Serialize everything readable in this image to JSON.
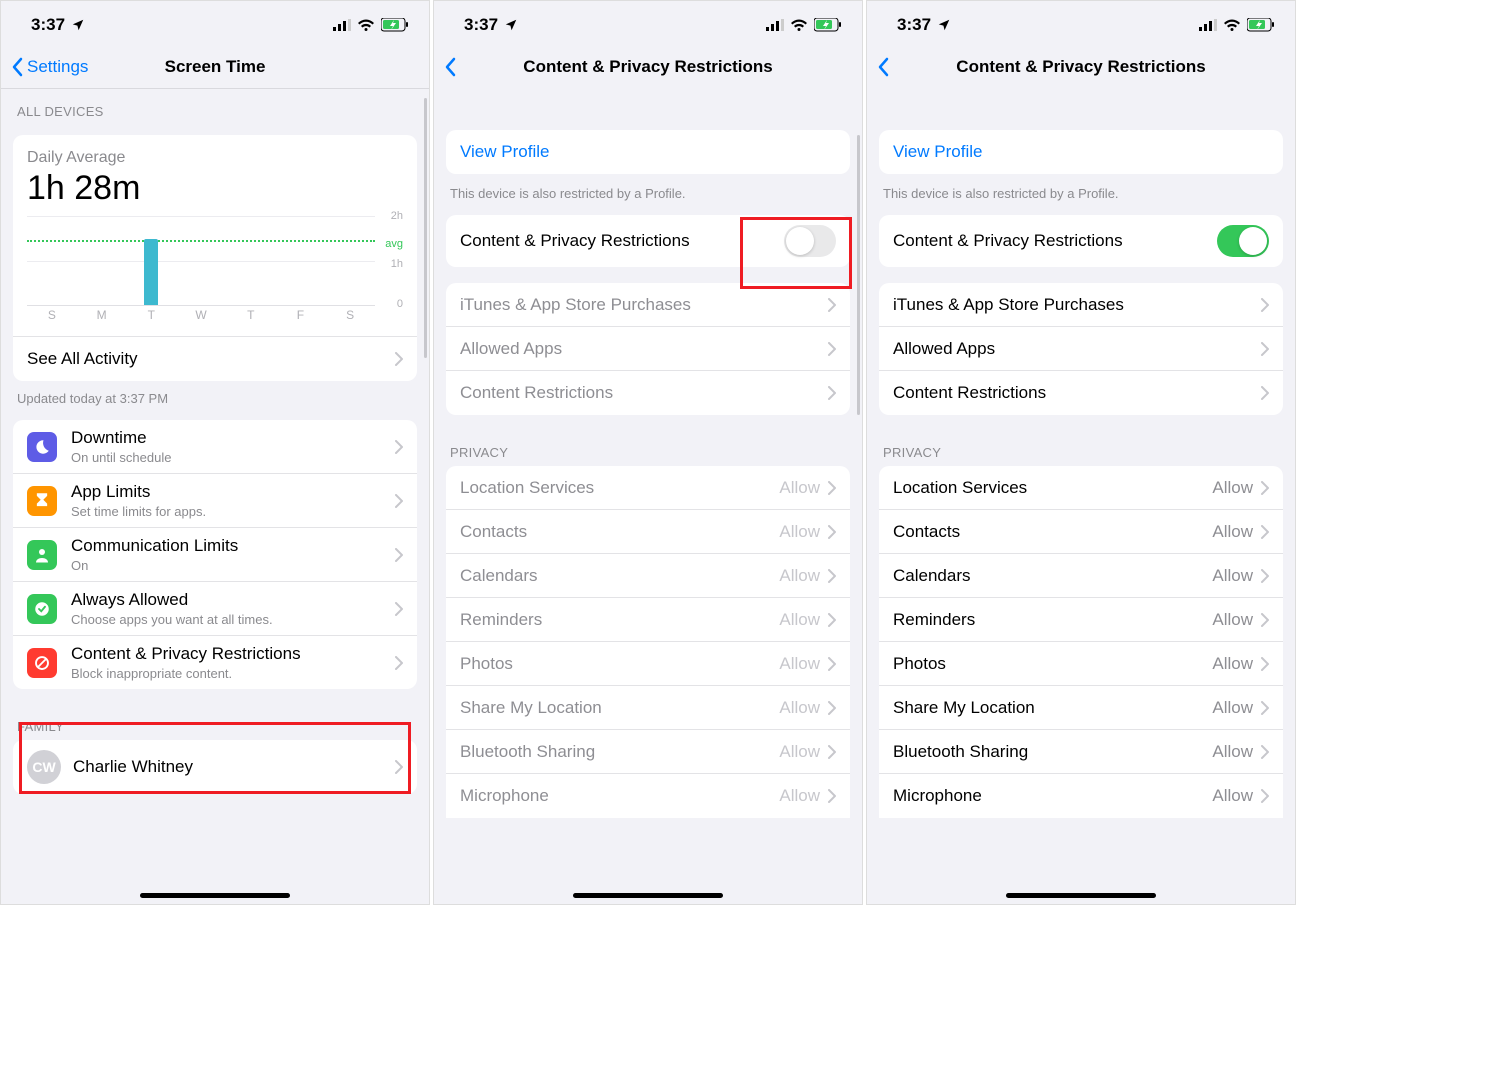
{
  "status": {
    "time": "3:37",
    "location_icon": "location-arrow"
  },
  "panel1": {
    "nav_back": "Settings",
    "nav_title": "Screen Time",
    "section_all_devices": "ALL DEVICES",
    "daily_average_label": "Daily Average",
    "daily_average_value": "1h 28m",
    "see_all": "See All Activity",
    "updated": "Updated today at 3:37 PM",
    "options": [
      {
        "title": "Downtime",
        "sub": "On until schedule",
        "color": "#5e5ce6",
        "icon": "moon"
      },
      {
        "title": "App Limits",
        "sub": "Set time limits for apps.",
        "color": "#ff9500",
        "icon": "hourglass"
      },
      {
        "title": "Communication Limits",
        "sub": "On",
        "color": "#34c759",
        "icon": "person"
      },
      {
        "title": "Always Allowed",
        "sub": "Choose apps you want at all times.",
        "color": "#34c759",
        "icon": "check-badge"
      },
      {
        "title": "Content & Privacy Restrictions",
        "sub": "Block inappropriate content.",
        "color": "#ff3b30",
        "icon": "nosign"
      }
    ],
    "family_header": "FAMILY",
    "family_member": "Charlie Whitney",
    "family_initials": "CW"
  },
  "panel2": {
    "title": "Content & Privacy Restrictions",
    "view_profile": "View Profile",
    "profile_note": "This device is also restricted by a Profile.",
    "toggle_label": "Content & Privacy Restrictions",
    "toggle_on": false,
    "group1": [
      "iTunes & App Store Purchases",
      "Allowed Apps",
      "Content Restrictions"
    ],
    "privacy_header": "PRIVACY",
    "privacy_items": [
      {
        "label": "Location Services",
        "value": "Allow"
      },
      {
        "label": "Contacts",
        "value": "Allow"
      },
      {
        "label": "Calendars",
        "value": "Allow"
      },
      {
        "label": "Reminders",
        "value": "Allow"
      },
      {
        "label": "Photos",
        "value": "Allow"
      },
      {
        "label": "Share My Location",
        "value": "Allow"
      },
      {
        "label": "Bluetooth Sharing",
        "value": "Allow"
      },
      {
        "label": "Microphone",
        "value": "Allow"
      }
    ]
  },
  "panel3": {
    "title": "Content & Privacy Restrictions",
    "view_profile": "View Profile",
    "profile_note": "This device is also restricted by a Profile.",
    "toggle_label": "Content & Privacy Restrictions",
    "toggle_on": true,
    "group1": [
      "iTunes & App Store Purchases",
      "Allowed Apps",
      "Content Restrictions"
    ],
    "privacy_header": "PRIVACY",
    "privacy_items": [
      {
        "label": "Location Services",
        "value": "Allow"
      },
      {
        "label": "Contacts",
        "value": "Allow"
      },
      {
        "label": "Calendars",
        "value": "Allow"
      },
      {
        "label": "Reminders",
        "value": "Allow"
      },
      {
        "label": "Photos",
        "value": "Allow"
      },
      {
        "label": "Share My Location",
        "value": "Allow"
      },
      {
        "label": "Bluetooth Sharing",
        "value": "Allow"
      },
      {
        "label": "Microphone",
        "value": "Allow"
      }
    ]
  },
  "chart_data": {
    "type": "bar",
    "categories": [
      "S",
      "M",
      "T",
      "W",
      "T",
      "F",
      "S"
    ],
    "values": [
      0,
      0,
      1.47,
      0,
      0,
      0,
      0
    ],
    "avg": 1.47,
    "ylim": [
      0,
      2
    ],
    "ylabels": [
      "2h",
      "avg",
      "1h",
      "0"
    ],
    "title": "Daily Average",
    "value_label": "1h 28m"
  }
}
